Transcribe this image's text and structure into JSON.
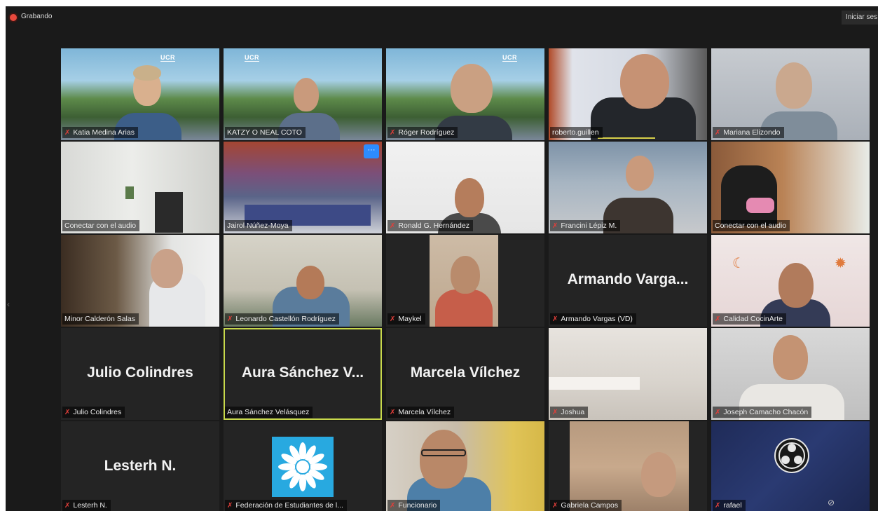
{
  "recording_label": "Grabando",
  "signin_label": "Iniciar ses",
  "tiles": [
    {
      "name": "Katia Medina Arias",
      "muted": true
    },
    {
      "name": "KATZY O NEAL COTO",
      "muted": false
    },
    {
      "name": "Róger Rodríguez",
      "muted": true
    },
    {
      "name": "roberto.guillen",
      "muted": false
    },
    {
      "name": "Mariana Elizondo",
      "muted": true
    },
    {
      "name": "Conectar con el audio",
      "muted": false
    },
    {
      "name": "Jairol Núñez-Moya",
      "muted": false
    },
    {
      "name": "Ronald G. Hernández",
      "muted": true
    },
    {
      "name": "Francini Lépiz M.",
      "muted": true
    },
    {
      "name": "Conectar con el audio",
      "muted": false
    },
    {
      "name": "Minor Calderón Salas",
      "muted": false
    },
    {
      "name": "Leonardo Castellón Rodríguez",
      "muted": true
    },
    {
      "name": "Maykel",
      "muted": true
    },
    {
      "name": "Armando Vargas (VD)",
      "muted": true,
      "display": "Armando Varga..."
    },
    {
      "name": "Calidad CocinArte",
      "muted": true
    },
    {
      "name": "Julio Colindres",
      "muted": true,
      "display": "Julio Colindres"
    },
    {
      "name": "Aura Sánchez Velásquez",
      "muted": false,
      "display": "Aura Sánchez V..."
    },
    {
      "name": "Marcela Vílchez",
      "muted": true,
      "display": "Marcela Vílchez"
    },
    {
      "name": "Joshua",
      "muted": true
    },
    {
      "name": "Joseph Camacho Chacón",
      "muted": true
    },
    {
      "name": "Lesterh N.",
      "muted": true,
      "display": "Lesterh N."
    },
    {
      "name": "Federación de Estudiantes de l...",
      "muted": true
    },
    {
      "name": "Funcionario",
      "muted": true
    },
    {
      "name": "Gabriela Campos",
      "muted": true
    },
    {
      "name": "rafael",
      "muted": true
    }
  ],
  "ucr_logo_text": "UCR",
  "colors": {
    "accent_active": "#c8d94b",
    "mute": "#e43f3a",
    "more": "#2d8cff"
  }
}
